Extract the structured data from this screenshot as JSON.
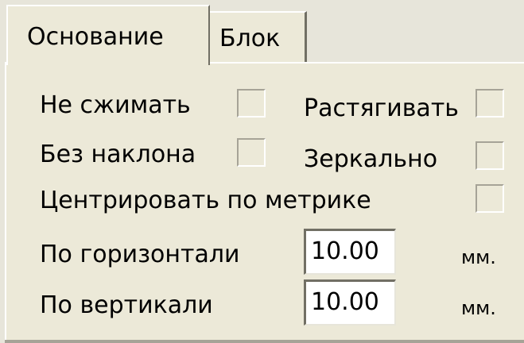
{
  "tabs": [
    {
      "label": "Основание",
      "active": true
    },
    {
      "label": "Блок",
      "active": false
    }
  ],
  "options": {
    "no_compress": {
      "label": "Не сжимать",
      "checked": false
    },
    "stretch": {
      "label": "Растягивать",
      "checked": false
    },
    "no_slant": {
      "label": "Без наклона",
      "checked": false
    },
    "mirror": {
      "label": "Зеркально",
      "checked": false
    },
    "center_by_metric": {
      "label": "Центрировать по метрике",
      "checked": false
    }
  },
  "horizontal": {
    "label": "По горизонтали",
    "value": "10.00",
    "unit": "мм."
  },
  "vertical": {
    "label": "По вертикали",
    "value": "10.00",
    "unit": "мм."
  },
  "colors": {
    "face": "#ece9d8",
    "shadow": "#716f64",
    "highlight": "#ffffff"
  }
}
